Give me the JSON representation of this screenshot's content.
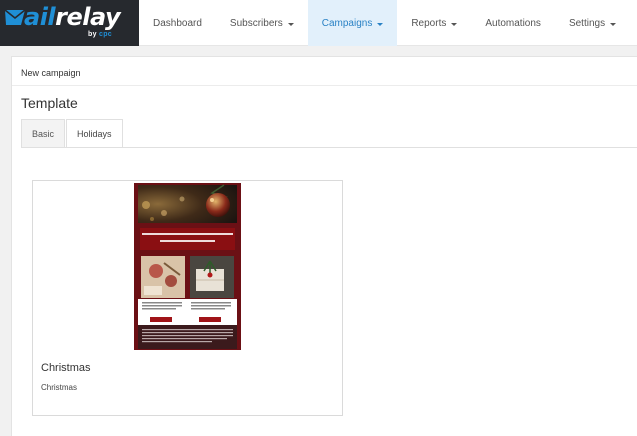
{
  "brand": {
    "logo_text_accent": "ail",
    "logo_text_main": "relay",
    "logo_by": "by",
    "logo_company": "cpc"
  },
  "nav": {
    "items": [
      {
        "label": "Dashboard",
        "dropdown": false,
        "active": false
      },
      {
        "label": "Subscribers",
        "dropdown": true,
        "active": false
      },
      {
        "label": "Campaigns",
        "dropdown": true,
        "active": true
      },
      {
        "label": "Reports",
        "dropdown": true,
        "active": false
      },
      {
        "label": "Automations",
        "dropdown": false,
        "active": false
      },
      {
        "label": "Settings",
        "dropdown": true,
        "active": false
      }
    ]
  },
  "breadcrumb": "New campaign",
  "page_title": "Template",
  "tabs": [
    {
      "label": "Basic",
      "active": false
    },
    {
      "label": "Holidays",
      "active": true
    }
  ],
  "templates": [
    {
      "name": "Christmas",
      "description": "Christmas",
      "preview_headline": "¡No te pierdas estas promociones navideñas!"
    }
  ],
  "colors": {
    "accent": "#2a82c5",
    "nav_active_bg": "#e2f0fb",
    "logo_bg": "#26292e",
    "template_bg": "#6b1015"
  }
}
